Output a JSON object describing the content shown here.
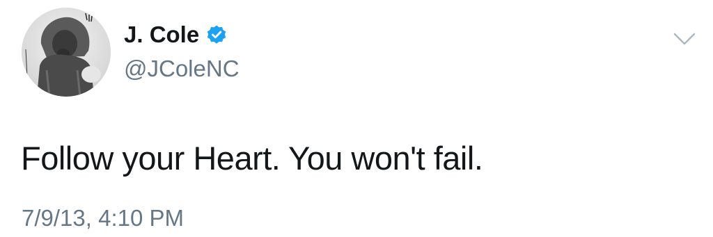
{
  "tweet": {
    "author": {
      "display_name": "J. Cole",
      "handle": "@JColeNC",
      "verified": true,
      "verified_icon": "verified-badge-icon",
      "avatar": "profile-photo-child-in-hooded-coat"
    },
    "text": "Follow your Heart. You won't fail.",
    "timestamp": "7/9/13, 4:10 PM",
    "menu_icon": "chevron-down-icon"
  },
  "colors": {
    "text": "#14171a",
    "secondary_text": "#657786",
    "verified_blue": "#1da1f2",
    "chevron": "#aab8c2",
    "background": "#ffffff"
  }
}
